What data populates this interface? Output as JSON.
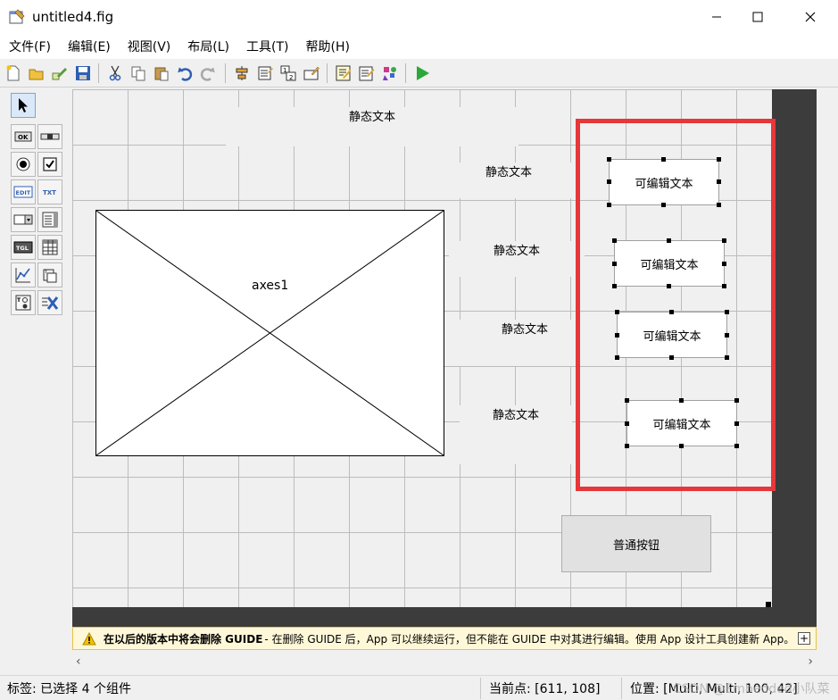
{
  "window": {
    "title": "untitled4.fig"
  },
  "menu": [
    "文件(F)",
    "编辑(E)",
    "视图(V)",
    "布局(L)",
    "工具(T)",
    "帮助(H)"
  ],
  "toolbar": {
    "icons": [
      "new-file-icon",
      "open-folder-icon",
      "edit-icon",
      "save-icon",
      "cut-icon",
      "copy-icon",
      "paste-icon",
      "undo-icon",
      "redo-icon",
      "align-icon",
      "menu-editor-icon",
      "tab-order-icon",
      "toolbar-editor-icon",
      "editor-icon",
      "property-inspector-icon",
      "object-browser-icon",
      "run-icon"
    ]
  },
  "palette": {
    "items": [
      {
        "name": "select-tool",
        "glyph": "select"
      },
      {
        "name": "pushbutton-tool",
        "glyph": "OK"
      },
      {
        "name": "slider-tool",
        "glyph": "slider"
      },
      {
        "name": "radio-tool",
        "glyph": "radio"
      },
      {
        "name": "checkbox-tool",
        "glyph": "check"
      },
      {
        "name": "edit-text-tool",
        "glyph": "EDIT"
      },
      {
        "name": "static-text-tool",
        "glyph": "TXT"
      },
      {
        "name": "popup-menu-tool",
        "glyph": "popup"
      },
      {
        "name": "listbox-tool",
        "glyph": "list"
      },
      {
        "name": "toggle-tool",
        "glyph": "TGL"
      },
      {
        "name": "table-tool",
        "glyph": "table"
      },
      {
        "name": "axes-tool",
        "glyph": "axes"
      },
      {
        "name": "panel-tool",
        "glyph": "panel"
      },
      {
        "name": "button-group-tool",
        "glyph": "group"
      },
      {
        "name": "activex-tool",
        "glyph": "X"
      }
    ]
  },
  "canvas": {
    "static_texts": [
      "静态文本",
      "静态文本",
      "静态文本",
      "静态文本",
      "静态文本"
    ],
    "edit_texts": [
      "可编辑文本",
      "可编辑文本",
      "可编辑文本",
      "可编辑文本"
    ],
    "axes_label": "axes1",
    "pushbutton": "普通按钮",
    "highlight_color": "#e6373a"
  },
  "warning": {
    "bold": "在以后的版本中将会删除 GUIDE",
    "text": " - 在删除 GUIDE 后，App 可以继续运行，但不能在 GUIDE 中对其进行编辑。使用 App 设计工具创建新 App。",
    "expand": "+"
  },
  "status": {
    "tag": "标签: 已选择 4 个组件",
    "current_point": "当前点:  [611, 108]",
    "position": "位置: [Multi, Multi, 100, 42]",
    "watermark": "CSDN @Embedded小队菜"
  }
}
